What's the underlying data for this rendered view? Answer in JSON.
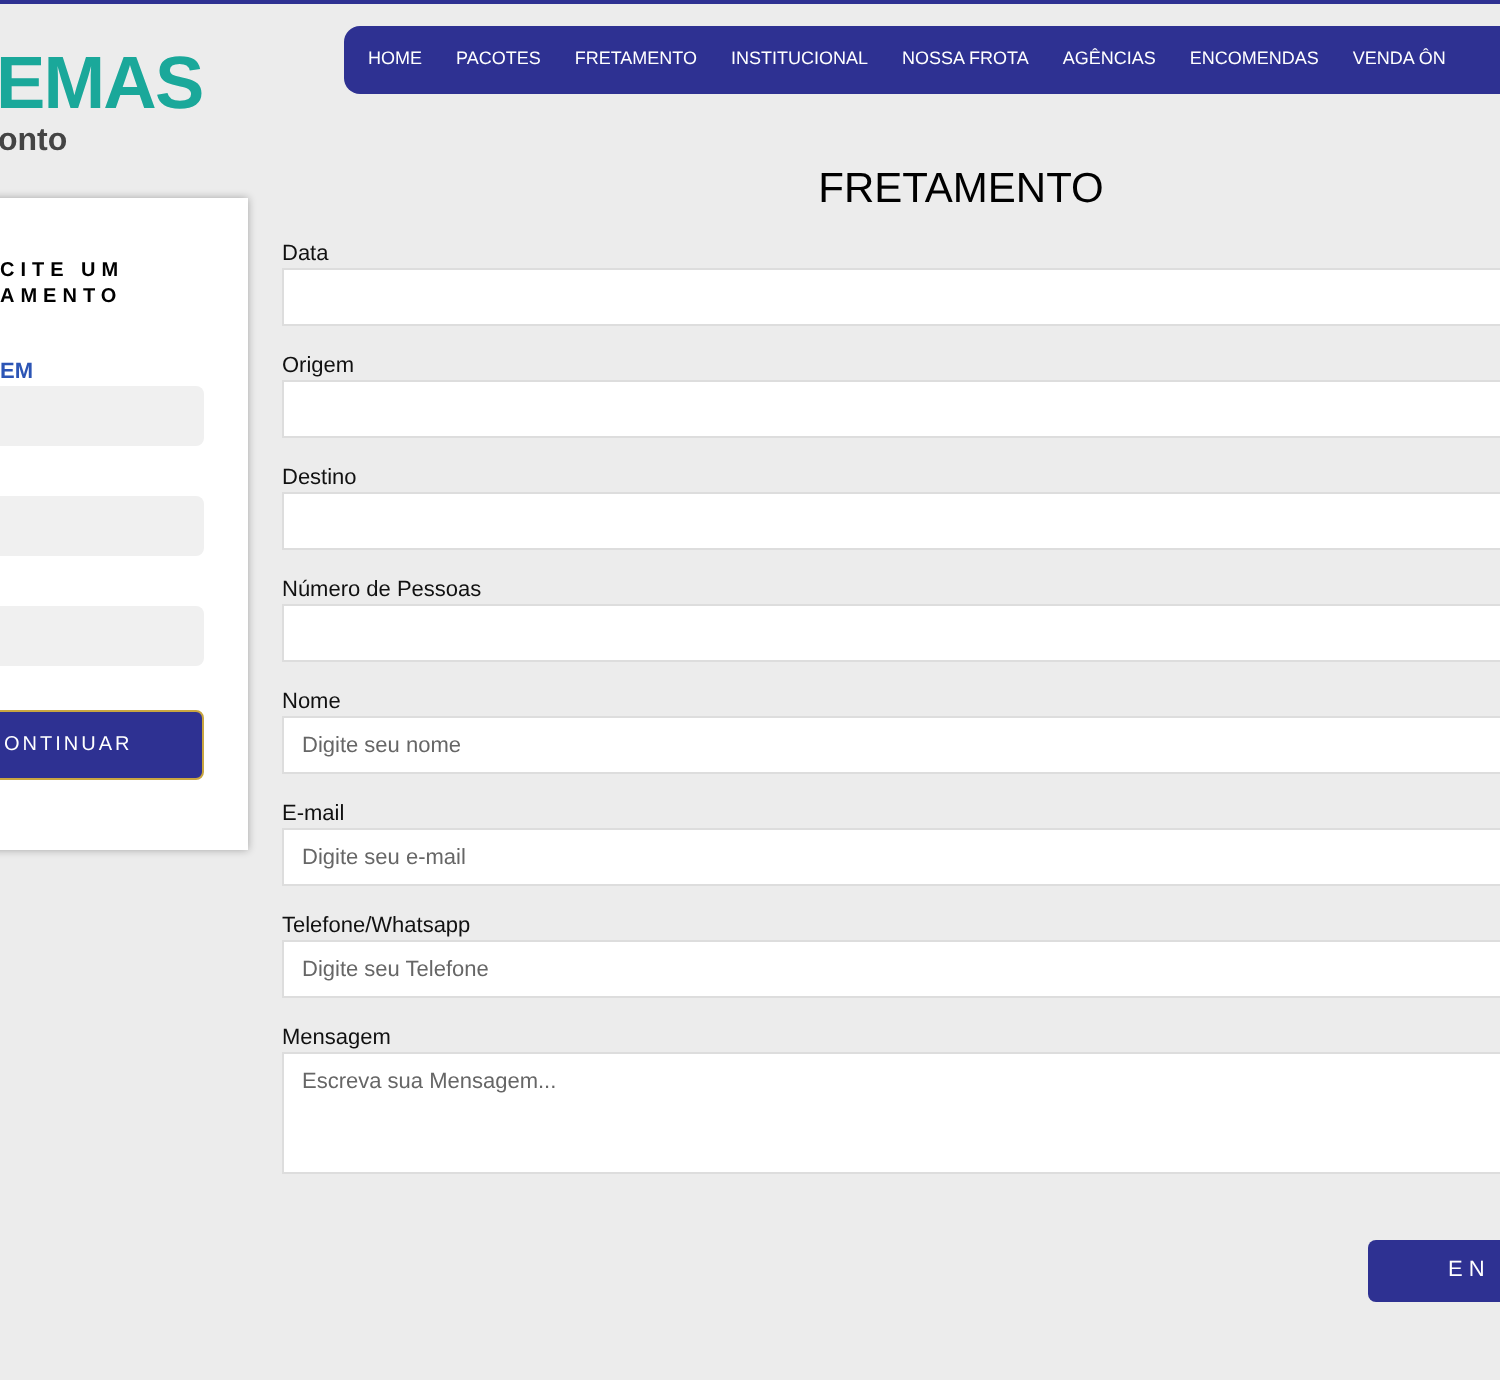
{
  "logo": {
    "title": "EMAS",
    "subtitle": "onto"
  },
  "nav": [
    {
      "label": "HOME"
    },
    {
      "label": "PACOTES"
    },
    {
      "label": "FRETAMENTO"
    },
    {
      "label": "INSTITUCIONAL"
    },
    {
      "label": "NOSSA FROTA"
    },
    {
      "label": "AGÊNCIAS"
    },
    {
      "label": "ENCOMENDAS"
    },
    {
      "label": "VENDA ÔN"
    }
  ],
  "sidebar": {
    "title_lines": [
      "CITE UM",
      "AMENTO"
    ],
    "label": "EM",
    "fields": [
      {
        "kind": "input"
      },
      {
        "kind": "input"
      },
      {
        "kind": "input"
      }
    ],
    "button": "ONTINUAR"
  },
  "page_title": "FRETAMENTO",
  "form": [
    {
      "label": "Data",
      "kind": "input"
    },
    {
      "label": "Origem",
      "kind": "input"
    },
    {
      "label": "Destino",
      "kind": "input"
    },
    {
      "label": "Número de Pessoas",
      "kind": "input"
    },
    {
      "label": "Nome",
      "kind": "input",
      "placeholder": "Digite seu nome"
    },
    {
      "label": "E-mail",
      "kind": "input",
      "placeholder": "Digite seu e-mail"
    },
    {
      "label": "Telefone/Whatsapp",
      "kind": "input",
      "placeholder": "Digite seu Telefone"
    },
    {
      "label": "Mensagem",
      "kind": "textarea",
      "placeholder": "Escreva sua Mensagem..."
    }
  ],
  "submit": "EN"
}
